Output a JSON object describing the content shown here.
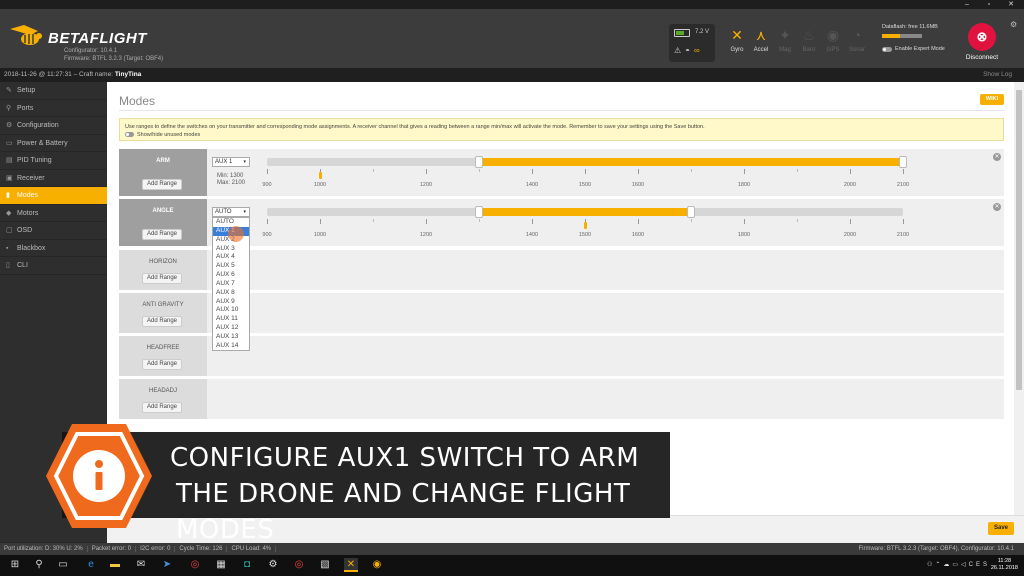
{
  "window": {
    "minimize": "–",
    "restore": "▫",
    "close": "✕"
  },
  "header": {
    "brand": "BETAFLIGHT",
    "configurator": "Configurator: 10.4.1",
    "firmware": "Firmware: BTFL 3.2.3 (Target: OBF4)",
    "battery_voltage": "7.2 V",
    "sensors": [
      {
        "label": "Gyro",
        "icon": "gyro-icon",
        "glyph": "✕",
        "active": true
      },
      {
        "label": "Accel",
        "icon": "accel-icon",
        "glyph": "⋏",
        "active": true
      },
      {
        "label": "Mag",
        "icon": "mag-icon",
        "glyph": "✦",
        "active": false
      },
      {
        "label": "Baro",
        "icon": "baro-icon",
        "glyph": "♨",
        "active": false
      },
      {
        "label": "GPS",
        "icon": "gps-icon",
        "glyph": "◉",
        "active": false
      },
      {
        "label": "Sonar",
        "icon": "sonar-icon",
        "glyph": "◔",
        "active": false
      }
    ],
    "dataflash": "Dataflash: free 11.6MB",
    "dataflash_used_fraction": 0.45,
    "expert_mode": "Enable Expert Mode",
    "disconnect": "Disconnect"
  },
  "strip": {
    "timestamp": "2018-11-26 @ 11:27:31",
    "craft_label": "– Craft name:",
    "craft_name": "TinyTina",
    "show_log": "Show Log"
  },
  "sidebar": [
    {
      "label": "Setup",
      "icon": "wrench-icon",
      "glyph": "✎"
    },
    {
      "label": "Ports",
      "icon": "ports-icon",
      "glyph": "⚲"
    },
    {
      "label": "Configuration",
      "icon": "gear-icon",
      "glyph": "⚙"
    },
    {
      "label": "Power & Battery",
      "icon": "battery-icon",
      "glyph": "▭"
    },
    {
      "label": "PID Tuning",
      "icon": "pid-icon",
      "glyph": "▤"
    },
    {
      "label": "Receiver",
      "icon": "receiver-icon",
      "glyph": "▣"
    },
    {
      "label": "Modes",
      "icon": "modes-icon",
      "glyph": "▮",
      "active": true
    },
    {
      "label": "Motors",
      "icon": "motors-icon",
      "glyph": "◆"
    },
    {
      "label": "OSD",
      "icon": "osd-icon",
      "glyph": "▢"
    },
    {
      "label": "Blackbox",
      "icon": "blackbox-icon",
      "glyph": "▪"
    },
    {
      "label": "CLI",
      "icon": "cli-icon",
      "glyph": "▯"
    }
  ],
  "main": {
    "title": "Modes",
    "wiki": "WIKI",
    "note": "Use ranges to define the switches on your transmitter and corresponding mode assignments. A receiver channel that gives a reading between a range min/max will activate the mode. Remember to save your settings using the Save button.",
    "show_hide": "Show/hide unused modes",
    "add_range": "Add Range",
    "tick_labels": [
      "900",
      "1000",
      "1200",
      "1400",
      "1500",
      "1600",
      "1800",
      "2000",
      "2100"
    ],
    "modes": [
      {
        "name": "ARM",
        "channel": "AUX 1",
        "min_label": "Min: 1300",
        "max_label": "Max: 2100",
        "range_min": 1300,
        "range_max": 2100,
        "live_value": 1000
      },
      {
        "name": "ANGLE",
        "channel": "AUTO",
        "range_min": 1300,
        "range_max": 1700,
        "live_value": 1500
      },
      {
        "name": "HORIZON"
      },
      {
        "name": "ANTI GRAVITY"
      },
      {
        "name": "HEADFREE"
      },
      {
        "name": "HEADADJ"
      }
    ],
    "dropdown_options": [
      "AUTO",
      "AUX 1",
      "AUX 2",
      "AUX 3",
      "AUX 4",
      "AUX 5",
      "AUX 6",
      "AUX 7",
      "AUX 8",
      "AUX 9",
      "AUX 10",
      "AUX 11",
      "AUX 12",
      "AUX 13",
      "AUX 14"
    ],
    "dropdown_selected": "AUX 1",
    "save": "Save"
  },
  "status": {
    "port_util": "Port utilization: D: 30% U: 2%",
    "packet_error": "Packet error: 0",
    "i2c_error": "I2C error: 0",
    "cycle_time": "Cycle Time: 126",
    "cpu_load": "CPU Load: 4%",
    "firmware": "Firmware: BTFL 3.2.3 (Target: OBF4), Configurator: 10.4.1"
  },
  "banner": {
    "line1": "CONFIGURE AUX1 SWITCH TO ARM",
    "line2": "THE DRONE AND CHANGE FLIGHT MODES",
    "icon": "info-icon"
  },
  "taskbar": {
    "language": "CES",
    "time": "11:28",
    "date": "26.11.2018",
    "accent": "#f8b000"
  }
}
